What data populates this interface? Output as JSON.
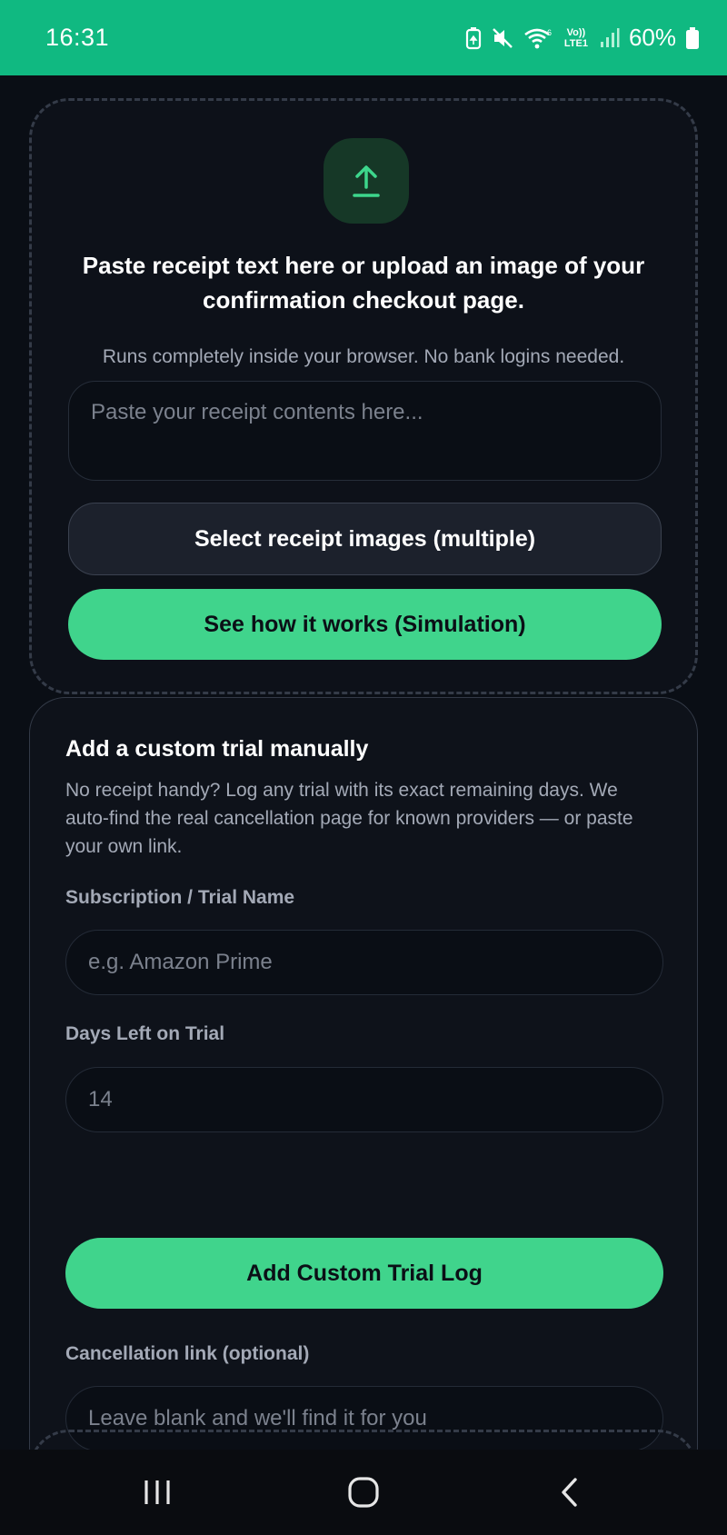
{
  "status_bar": {
    "time": "16:31",
    "battery_percent": "60%",
    "network_label": "Vo)) LTE1",
    "icons": [
      "battery-saver-icon",
      "mute-icon",
      "wifi-icon",
      "volte-icon",
      "signal-icon",
      "battery-icon"
    ]
  },
  "upload": {
    "icon": "upload-arrow-icon",
    "title": "Paste receipt text here or upload an image of your confirmation checkout page.",
    "subtitle": "Runs completely inside your browser. No bank logins needed.",
    "textarea_placeholder": "Paste your receipt contents here...",
    "select_button_label": "Select receipt images (multiple)",
    "simulation_button_label": "See how it works (Simulation)"
  },
  "custom_trial": {
    "title": "Add a custom trial manually",
    "description": "No receipt handy? Log any trial with its exact remaining days. We auto-find the real cancellation page for known providers — or paste your own link.",
    "name_label": "Subscription / Trial Name",
    "name_placeholder": "e.g. Amazon Prime",
    "days_label": "Days Left on Trial",
    "days_placeholder": "14",
    "add_button_label": "Add Custom Trial Log",
    "link_label": "Cancellation link (optional)",
    "link_placeholder": "Leave blank and we'll find it for you"
  },
  "colors": {
    "status_bar": "#10b981",
    "accent": "#40d48c",
    "background": "#0a0e15"
  },
  "nav_bar": {
    "icons": [
      "recent-apps-icon",
      "home-icon",
      "back-icon"
    ]
  }
}
